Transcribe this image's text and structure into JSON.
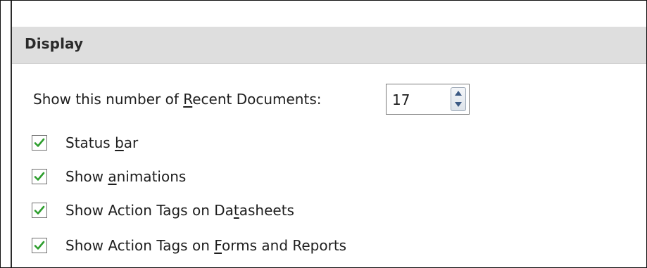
{
  "section": {
    "title": "Display"
  },
  "recent_documents": {
    "label_before": "Show this number of ",
    "label_accel": "R",
    "label_after": "ecent Documents:",
    "value": "17"
  },
  "options": [
    {
      "before": "Status ",
      "accel": "b",
      "after": "ar",
      "checked": true
    },
    {
      "before": "Show ",
      "accel": "a",
      "after": "nimations",
      "checked": true
    },
    {
      "before": "Show Action Tags on Da",
      "accel": "t",
      "after": "asheets",
      "checked": true
    },
    {
      "before": "Show Action Tags on ",
      "accel": "F",
      "after": "orms and Reports",
      "checked": true
    }
  ],
  "colors": {
    "header_bg": "#dedede",
    "check_mark": "#2e9e2e",
    "spin_arrow": "#3c5a84"
  },
  "icons": {
    "checkbox": "check-mark-icon",
    "spin_up": "arrow-up-icon",
    "spin_down": "arrow-down-icon"
  }
}
